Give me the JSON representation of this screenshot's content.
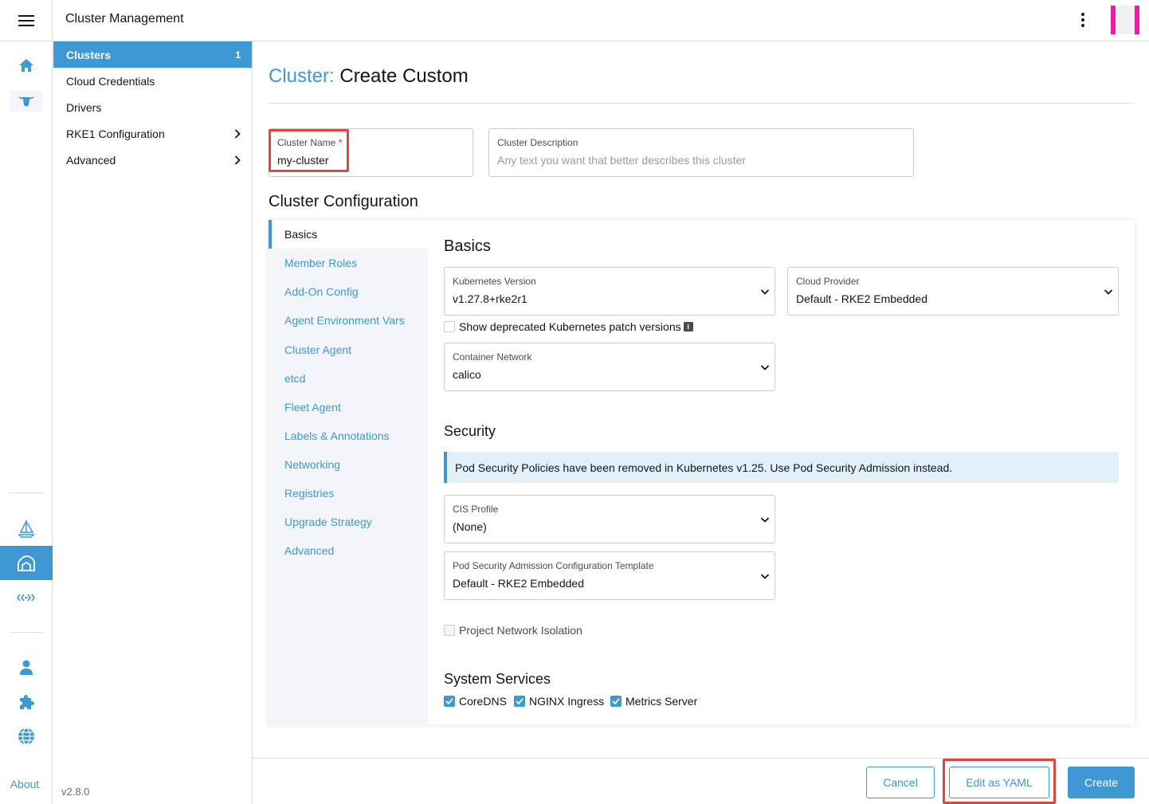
{
  "header": {
    "title": "Cluster Management"
  },
  "rail": {
    "about": "About"
  },
  "sidenav": {
    "items": [
      {
        "label": "Clusters",
        "count": "1"
      },
      {
        "label": "Cloud Credentials"
      },
      {
        "label": "Drivers"
      },
      {
        "label": "RKE1 Configuration"
      },
      {
        "label": "Advanced"
      }
    ],
    "version": "v2.8.0"
  },
  "page": {
    "crumb": "Cluster:",
    "title": "Create Custom"
  },
  "cluster_name": {
    "label": "Cluster Name",
    "required_mark": "*",
    "value": "my-cluster"
  },
  "cluster_description": {
    "label": "Cluster Description",
    "placeholder": "Any text you want that better describes this cluster"
  },
  "config": {
    "heading": "Cluster Configuration",
    "tabs": [
      "Basics",
      "Member Roles",
      "Add-On Config",
      "Agent Environment Vars",
      "Cluster Agent",
      "etcd",
      "Fleet Agent",
      "Labels & Annotations",
      "Networking",
      "Registries",
      "Upgrade Strategy",
      "Advanced"
    ]
  },
  "basics": {
    "heading": "Basics",
    "kubernetes_version": {
      "label": "Kubernetes Version",
      "value": "v1.27.8+rke2r1"
    },
    "cloud_provider": {
      "label": "Cloud Provider",
      "value": "Default - RKE2 Embedded"
    },
    "show_deprecated": "Show deprecated Kubernetes patch versions",
    "container_network": {
      "label": "Container Network",
      "value": "calico"
    }
  },
  "security": {
    "heading": "Security",
    "banner": "Pod Security Policies have been removed in Kubernetes v1.25. Use Pod Security Admission instead.",
    "cis_profile": {
      "label": "CIS Profile",
      "value": "(None)"
    },
    "psa_template": {
      "label": "Pod Security Admission Configuration Template",
      "value": "Default - RKE2 Embedded"
    },
    "project_network_isolation": "Project Network Isolation"
  },
  "system_services": {
    "heading": "System Services",
    "items": [
      "CoreDNS",
      "NGINX Ingress",
      "Metrics Server"
    ]
  },
  "footer": {
    "cancel": "Cancel",
    "edit_yaml": "Edit as YAML",
    "create": "Create"
  },
  "colors": {
    "accent": "#3d98d3",
    "highlight": "#e0463f",
    "avatar": "#e91ba9"
  }
}
